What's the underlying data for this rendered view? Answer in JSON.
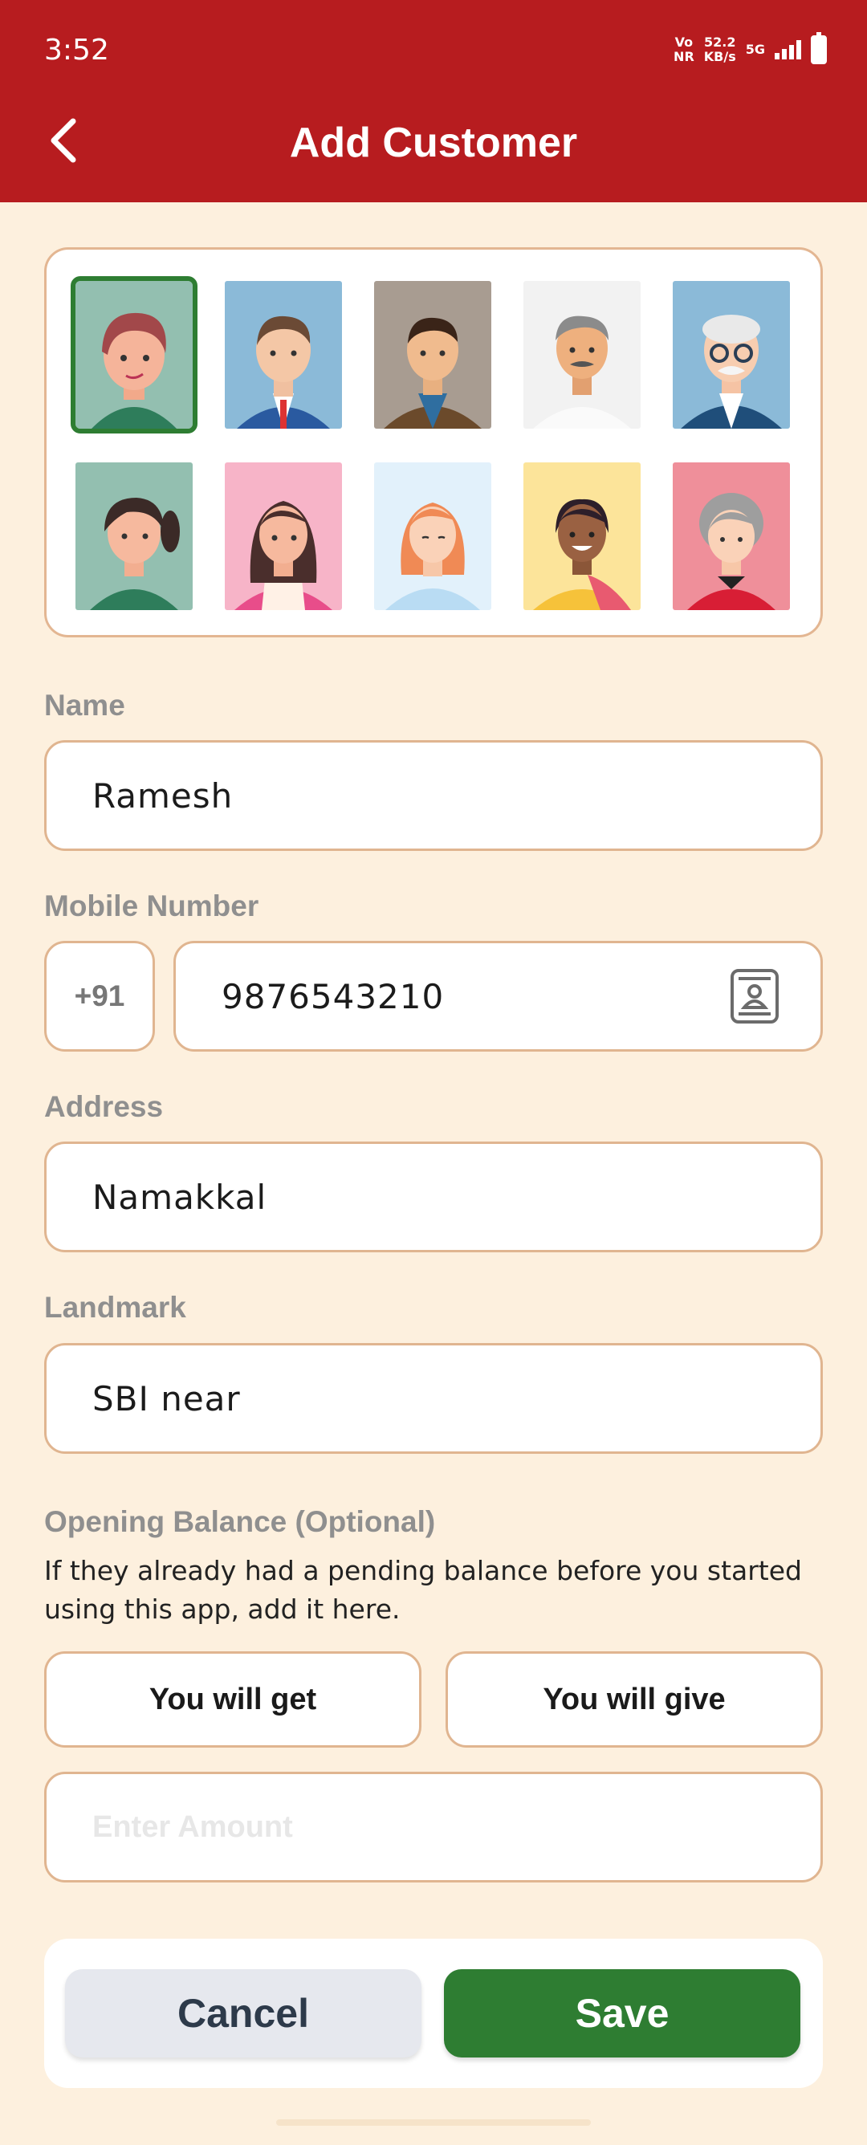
{
  "status_bar": {
    "time": "3:52",
    "network_top": "Vo",
    "network_bottom": "NR",
    "speed_top": "52.2",
    "speed_bottom": "KB/s",
    "signal_label": "5G"
  },
  "header": {
    "title": "Add Customer",
    "back_icon": "chevron-left-icon"
  },
  "avatars": {
    "selected_index": 0,
    "items": [
      {
        "name": "boy"
      },
      {
        "name": "man-tie"
      },
      {
        "name": "man-jacket"
      },
      {
        "name": "elderly-man-mustache"
      },
      {
        "name": "elderly-man-glasses"
      },
      {
        "name": "girl-ponytail"
      },
      {
        "name": "woman-long-hair"
      },
      {
        "name": "woman-red-hair"
      },
      {
        "name": "woman-saree"
      },
      {
        "name": "elderly-woman"
      }
    ]
  },
  "form": {
    "name_label": "Name",
    "name_value": "Ramesh",
    "mobile_label": "Mobile Number",
    "country_code": "+91",
    "mobile_value": "9876543210",
    "contact_icon": "contact-book-icon",
    "address_label": "Address",
    "address_value": "Namakkal",
    "landmark_label": "Landmark",
    "landmark_value": "SBI near",
    "opening_label": "Opening Balance (Optional)",
    "opening_helper": "If they already had a pending balance before you started using this app, add it here.",
    "you_will_get": "You will get",
    "you_will_give": "You will give",
    "amount_placeholder": "Enter Amount"
  },
  "actions": {
    "cancel": "Cancel",
    "save": "Save"
  },
  "colors": {
    "appbar": "#b71c1f",
    "background": "#fdf0de",
    "accent_green": "#2e7d32",
    "field_border": "#e0b590"
  }
}
